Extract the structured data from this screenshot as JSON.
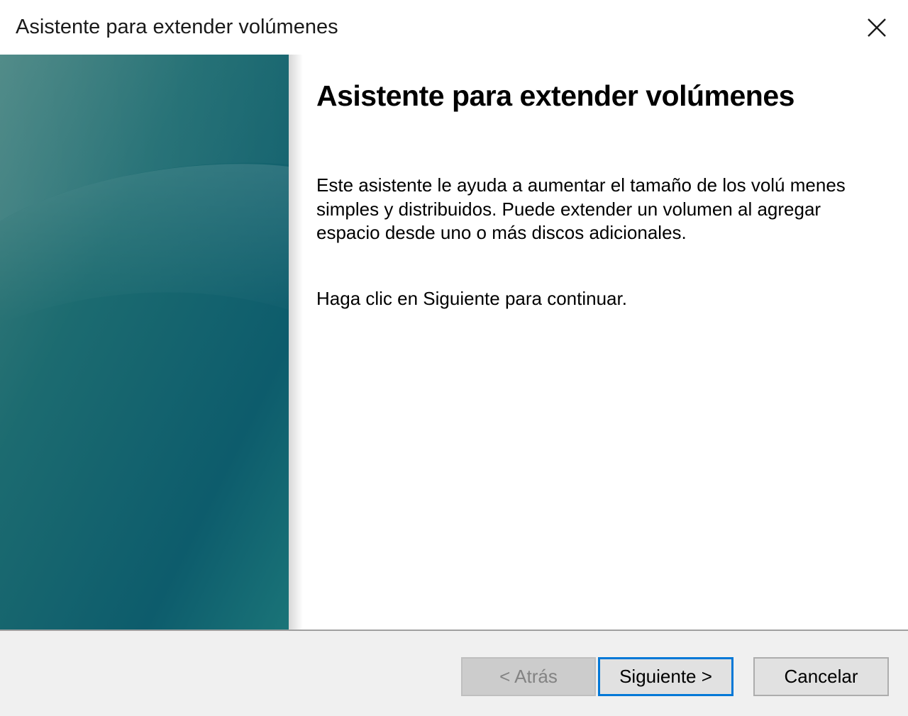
{
  "window": {
    "title": "Asistente para extender volúmenes",
    "close_icon": "close-icon"
  },
  "main": {
    "heading": "Asistente para extender volúmenes",
    "description": "Este asistente le ayuda a aumentar el tamaño de los volú menes simples y distribuidos. Puede extender un volumen al agregar espacio desde uno o más discos adicionales.",
    "instruction": "Haga clic en Siguiente para continuar."
  },
  "buttons": {
    "back_label": "< Atrás",
    "next_label": "Siguiente >",
    "cancel_label": "Cancelar"
  },
  "colors": {
    "banner_top": "#3f7d7c",
    "banner_bottom": "#16707a",
    "focus_border": "#0078d7"
  }
}
